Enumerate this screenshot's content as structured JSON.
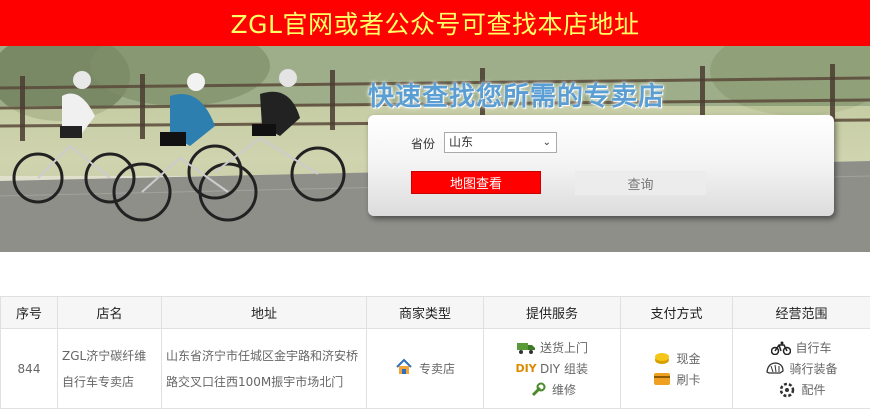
{
  "banner": {
    "text": "ZGL官网或者公众号可查找本店地址"
  },
  "hero": {
    "title": "快速查找您所需的专卖店",
    "province_label": "省份",
    "province_selected": "山东",
    "map_button": "地图查看",
    "query_button": "查询"
  },
  "table": {
    "headers": [
      "序号",
      "店名",
      "地址",
      "商家类型",
      "提供服务",
      "支付方式",
      "经营范围"
    ],
    "row": {
      "id": "844",
      "name": "ZGL济宁碳纤维自行车专卖店",
      "address": "山东省济宁市任城区金宇路和济安桥路交叉口往西100M振宇市场北门",
      "type": "专卖店",
      "services": [
        "送货上门",
        "DIY 组装",
        "维修"
      ],
      "payments": [
        "现金",
        "刷卡"
      ],
      "scope": [
        "自行车",
        "骑行装备",
        "配件"
      ]
    }
  },
  "icons": [
    "truck-icon",
    "diy-icon",
    "wrench-icon",
    "coin-icon",
    "card-icon",
    "bike-icon",
    "helmet-icon",
    "parts-icon",
    "house-icon"
  ]
}
